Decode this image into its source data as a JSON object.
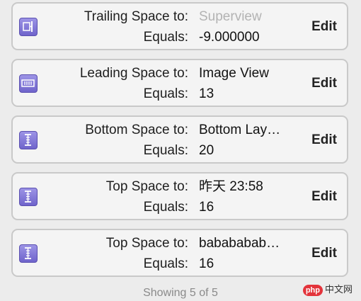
{
  "constraints": [
    {
      "label": "Trailing Space to:",
      "target": "Superview",
      "target_muted": true,
      "equals_label": "Equals:",
      "equals_value": "-9.000000",
      "edit_label": "Edit",
      "icon": "trailing-space-icon"
    },
    {
      "label": "Leading Space to:",
      "target": "Image View",
      "target_muted": false,
      "equals_label": "Equals:",
      "equals_value": "13",
      "edit_label": "Edit",
      "icon": "leading-space-icon"
    },
    {
      "label": "Bottom Space to:",
      "target": "Bottom Lay…",
      "target_muted": false,
      "equals_label": "Equals:",
      "equals_value": "20",
      "edit_label": "Edit",
      "icon": "vertical-space-icon"
    },
    {
      "label": "Top Space to:",
      "target": "昨天 23:58",
      "target_muted": false,
      "equals_label": "Equals:",
      "equals_value": "16",
      "edit_label": "Edit",
      "icon": "vertical-space-icon"
    },
    {
      "label": "Top Space to:",
      "target": "babababab…",
      "target_muted": false,
      "equals_label": "Equals:",
      "equals_value": "16",
      "edit_label": "Edit",
      "icon": "vertical-space-icon"
    }
  ],
  "footer": {
    "text": "Showing 5 of 5"
  },
  "watermark": {
    "badge": "php",
    "text": "中文网"
  },
  "colors": {
    "icon_fill": "#8a80dc",
    "muted_text": "#b3b3b3",
    "row_border": "#c9c9c9"
  }
}
